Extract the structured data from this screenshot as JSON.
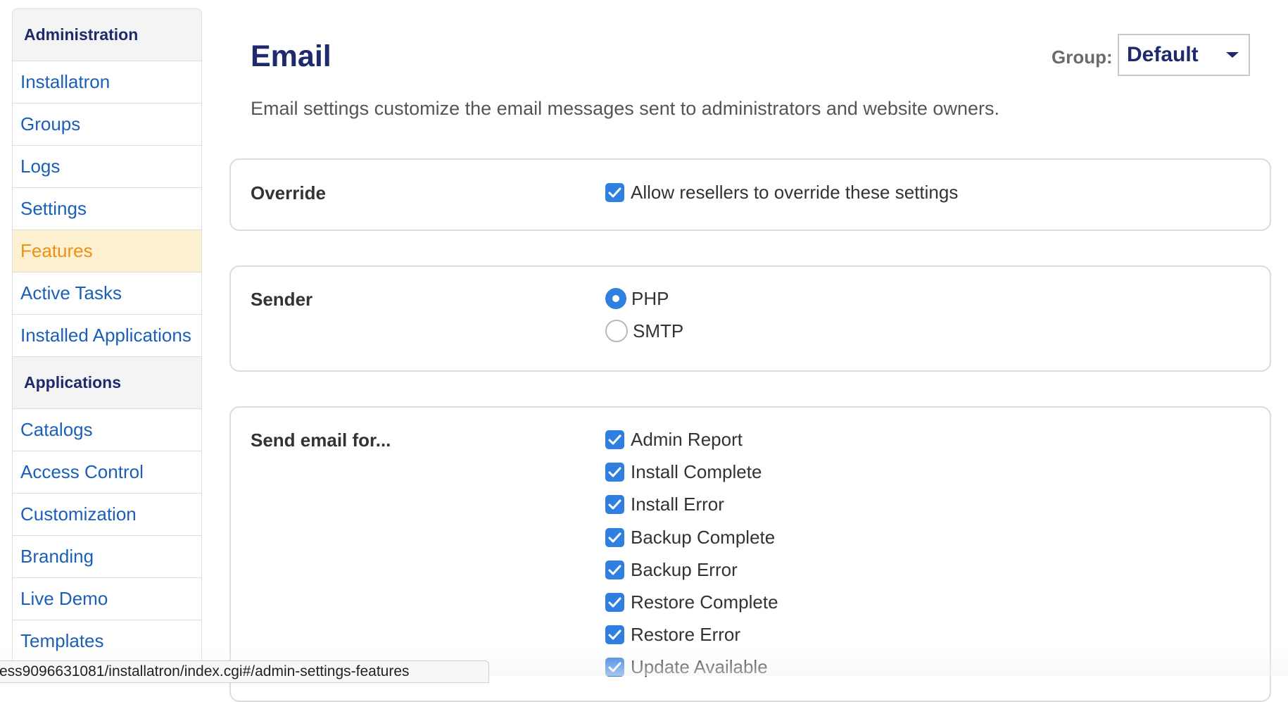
{
  "sidebar": {
    "sections": [
      {
        "title": "Administration",
        "items": [
          {
            "label": "Installatron",
            "active": false
          },
          {
            "label": "Groups",
            "active": false
          },
          {
            "label": "Logs",
            "active": false
          },
          {
            "label": "Settings",
            "active": false
          },
          {
            "label": "Features",
            "active": true
          },
          {
            "label": "Active Tasks",
            "active": false
          },
          {
            "label": "Installed Applications",
            "active": false
          }
        ]
      },
      {
        "title": "Applications",
        "items": [
          {
            "label": "Catalogs",
            "active": false
          },
          {
            "label": "Access Control",
            "active": false
          },
          {
            "label": "Customization",
            "active": false
          },
          {
            "label": "Branding",
            "active": false
          },
          {
            "label": "Live Demo",
            "active": false
          },
          {
            "label": "Templates",
            "active": false
          }
        ]
      }
    ]
  },
  "header": {
    "title": "Email",
    "group_label": "Group:",
    "group_value": "Default",
    "description": "Email settings customize the email messages sent to administrators and website owners."
  },
  "override": {
    "label": "Override",
    "option": {
      "label": "Allow resellers to override these settings",
      "checked": true
    }
  },
  "sender": {
    "label": "Sender",
    "options": [
      {
        "label": "PHP",
        "selected": true
      },
      {
        "label": "SMTP",
        "selected": false
      }
    ]
  },
  "send_email": {
    "label": "Send email for...",
    "options": [
      {
        "label": "Admin Report",
        "checked": true
      },
      {
        "label": "Install Complete",
        "checked": true
      },
      {
        "label": "Install Error",
        "checked": true
      },
      {
        "label": "Backup Complete",
        "checked": true
      },
      {
        "label": "Backup Error",
        "checked": true
      },
      {
        "label": "Restore Complete",
        "checked": true
      },
      {
        "label": "Restore Error",
        "checked": true
      },
      {
        "label": "Update Available",
        "checked": true
      }
    ]
  },
  "status_bar": {
    "url": "ess9096631081/installatron/index.cgi#/admin-settings-features"
  },
  "colors": {
    "nav_link": "#1b5fb8",
    "nav_active": "#ef8f14",
    "nav_active_bg": "#fdf1d2",
    "heading": "#1e2a6b",
    "checkbox": "#2f7fe0"
  }
}
